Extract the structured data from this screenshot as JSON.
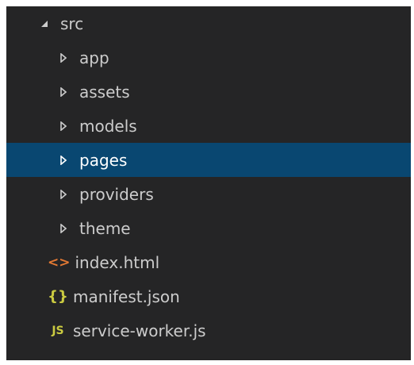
{
  "explorer": {
    "root": {
      "label": "src",
      "expanded": true,
      "icon": "triangle-down-icon"
    },
    "folders": [
      {
        "label": "app",
        "icon": "triangle-right-icon",
        "selected": false
      },
      {
        "label": "assets",
        "icon": "triangle-right-icon",
        "selected": false
      },
      {
        "label": "models",
        "icon": "triangle-right-icon",
        "selected": false
      },
      {
        "label": "pages",
        "icon": "triangle-right-icon",
        "selected": true
      },
      {
        "label": "providers",
        "icon": "triangle-right-icon",
        "selected": false
      },
      {
        "label": "theme",
        "icon": "triangle-right-icon",
        "selected": false
      }
    ],
    "files": [
      {
        "label": "index.html",
        "icon": "html-file-icon",
        "glyph": "<>",
        "color": "#e37933"
      },
      {
        "label": "manifest.json",
        "icon": "json-file-icon",
        "glyph": "{}",
        "color": "#cbcb41"
      },
      {
        "label": "service-worker.js",
        "icon": "js-file-icon",
        "glyph": "JS",
        "color": "#cbcb41"
      }
    ],
    "colors": {
      "background": "#252526",
      "selected": "#094771",
      "text": "#cccccc"
    }
  }
}
